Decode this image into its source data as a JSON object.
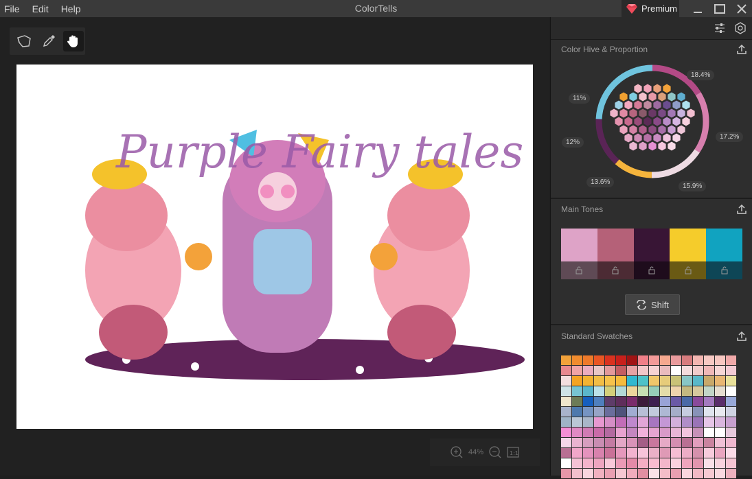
{
  "menu": {
    "file": "File",
    "edit": "Edit",
    "help": "Help"
  },
  "app": {
    "title": "ColorTells",
    "premium_label": "Premium"
  },
  "canvas": {
    "title_text": "Purple Fairy tales",
    "zoom": "44%"
  },
  "panel": {
    "hive_title": "Color Hive & Proportion",
    "percentages": {
      "p1": "18.4%",
      "p2": "17.2%",
      "p3": "15.9%",
      "p4": "13.6%",
      "p5": "12%",
      "p6": "11%"
    },
    "main_tones_title": "Main Tones",
    "shift_label": "Shift",
    "swatches_title": "Standard Swatches"
  },
  "main_tones": [
    {
      "color": "#dea3c7",
      "lock": "#5f4a55"
    },
    {
      "color": "#b56178",
      "lock": "#4c2b34"
    },
    {
      "color": "#381535",
      "lock": "#1e0c1c"
    },
    {
      "color": "#f5cc2b",
      "lock": "#6a5a14"
    },
    {
      "color": "#11a3c0",
      "lock": "#0e4656"
    }
  ],
  "swatch_colors": [
    "#f2a23a",
    "#f18c2e",
    "#ef7a2a",
    "#e95624",
    "#d9321f",
    "#c8201b",
    "#a01414",
    "#f07f88",
    "#f39a99",
    "#f5a88f",
    "#e99b9d",
    "#d77c7e",
    "#f3b6b1",
    "#f7c9c3",
    "#f7c7c1",
    "#f0a9a9",
    "#e8888f",
    "#f1a4a6",
    "#ecadc0",
    "#e9c7c7",
    "#e3999b",
    "#c45e62",
    "#e7a3a4",
    "#f3c7c9",
    "#f6d2d4",
    "#e9bbbe",
    "#ffffff",
    "#f4dcdd",
    "#f1cbcb",
    "#f0b8b8",
    "#f6d6d6",
    "#f3cbd4",
    "#f3dede",
    "#f5a423",
    "#f3b332",
    "#f2bd46",
    "#f6c24b",
    "#f5bb3c",
    "#30b8cf",
    "#4ec2c8",
    "#f0c66a",
    "#e6cc7b",
    "#c9c277",
    "#88c6c6",
    "#59b8c8",
    "#c8a86a",
    "#e8b673",
    "#e8e09a",
    "#cfe3e6",
    "#77c4d2",
    "#5bb7cb",
    "#bbe1e8",
    "#d3cf7a",
    "#b3d9d6",
    "#ecd79c",
    "#c6e0b3",
    "#96cdb9",
    "#e4dca9",
    "#efd4ac",
    "#c4b980",
    "#d6c99d",
    "#c2d6c7",
    "#e6ded0",
    "#ffffff",
    "#efe6cc",
    "#6c7b56",
    "#165fbe",
    "#4f7fbd",
    "#5e3c69",
    "#5f2e5b",
    "#7a2b6b",
    "#3c1b3a",
    "#3e2050",
    "#99a3d6",
    "#6a5aa6",
    "#4a6aa6",
    "#8a4a9a",
    "#a37abf",
    "#5a2e6a",
    "#97a8d8",
    "#a8b3cb",
    "#4d79ad",
    "#7594c2",
    "#97a4c6",
    "#6a6d9c",
    "#4f537b",
    "#a1acd2",
    "#b8bfd6",
    "#c2cbdc",
    "#aeb8d4",
    "#a5aec9",
    "#c6cde0",
    "#8893b8",
    "#dfe4ee",
    "#e8eaf0",
    "#cfd3e3",
    "#9fb3c6",
    "#bac7d6",
    "#a9b6c8",
    "#e798d0",
    "#d58ec6",
    "#c26db7",
    "#bf88cd",
    "#e2a5d7",
    "#a776c0",
    "#c497d6",
    "#d3b0dc",
    "#b08ec8",
    "#9a74b7",
    "#e6c6e8",
    "#d9b6de",
    "#c7a0cf",
    "#f48fd6",
    "#e08ac4",
    "#d07bb4",
    "#c96ba8",
    "#b36aa0",
    "#e8a3d0",
    "#c487c0",
    "#f1b1db",
    "#e6a4d0",
    "#d99ac8",
    "#e8b6d6",
    "#f3c4df",
    "#c791b8",
    "#ffffff",
    "#ffffff",
    "#e6c9dc",
    "#f5d6e9",
    "#eab4d1",
    "#d79ebf",
    "#c98db2",
    "#c47ba3",
    "#e4a7c6",
    "#d993b8",
    "#a45e86",
    "#c9779d",
    "#e6aac6",
    "#d58eb1",
    "#b97093",
    "#e29ebd",
    "#c9839f",
    "#f0c1d6",
    "#efb8cf",
    "#b86f93",
    "#f1a6c9",
    "#e493bd",
    "#d882ad",
    "#c97198",
    "#e598bc",
    "#f2b3cf",
    "#f7c4da",
    "#eab0c7",
    "#df9ab6",
    "#f5bdd3",
    "#edadc6",
    "#d691ac",
    "#f7cbdc",
    "#e9a6c0",
    "#fbdbe7",
    "#ffffff",
    "#f5c2d5",
    "#f4b4cc",
    "#eea5c0",
    "#f8c9d9",
    "#ea9bb6",
    "#e48aa8",
    "#f5aec4",
    "#f7bcd0",
    "#f3b6ca",
    "#fad2df",
    "#efa5bd",
    "#e295ae",
    "#fbe0e9",
    "#f8d3de",
    "#f5c5d3",
    "#e697a9",
    "#f3c0cd",
    "#f9d6df",
    "#f1b1c0",
    "#eaa0b2",
    "#f6c8d2",
    "#f0acbc",
    "#e18fa2",
    "#fbe2e8",
    "#f4bdc8",
    "#e79fb0",
    "#fad6de",
    "#f2b9c5",
    "#f7cad3",
    "#f9d9e0",
    "#ecb0bd"
  ]
}
